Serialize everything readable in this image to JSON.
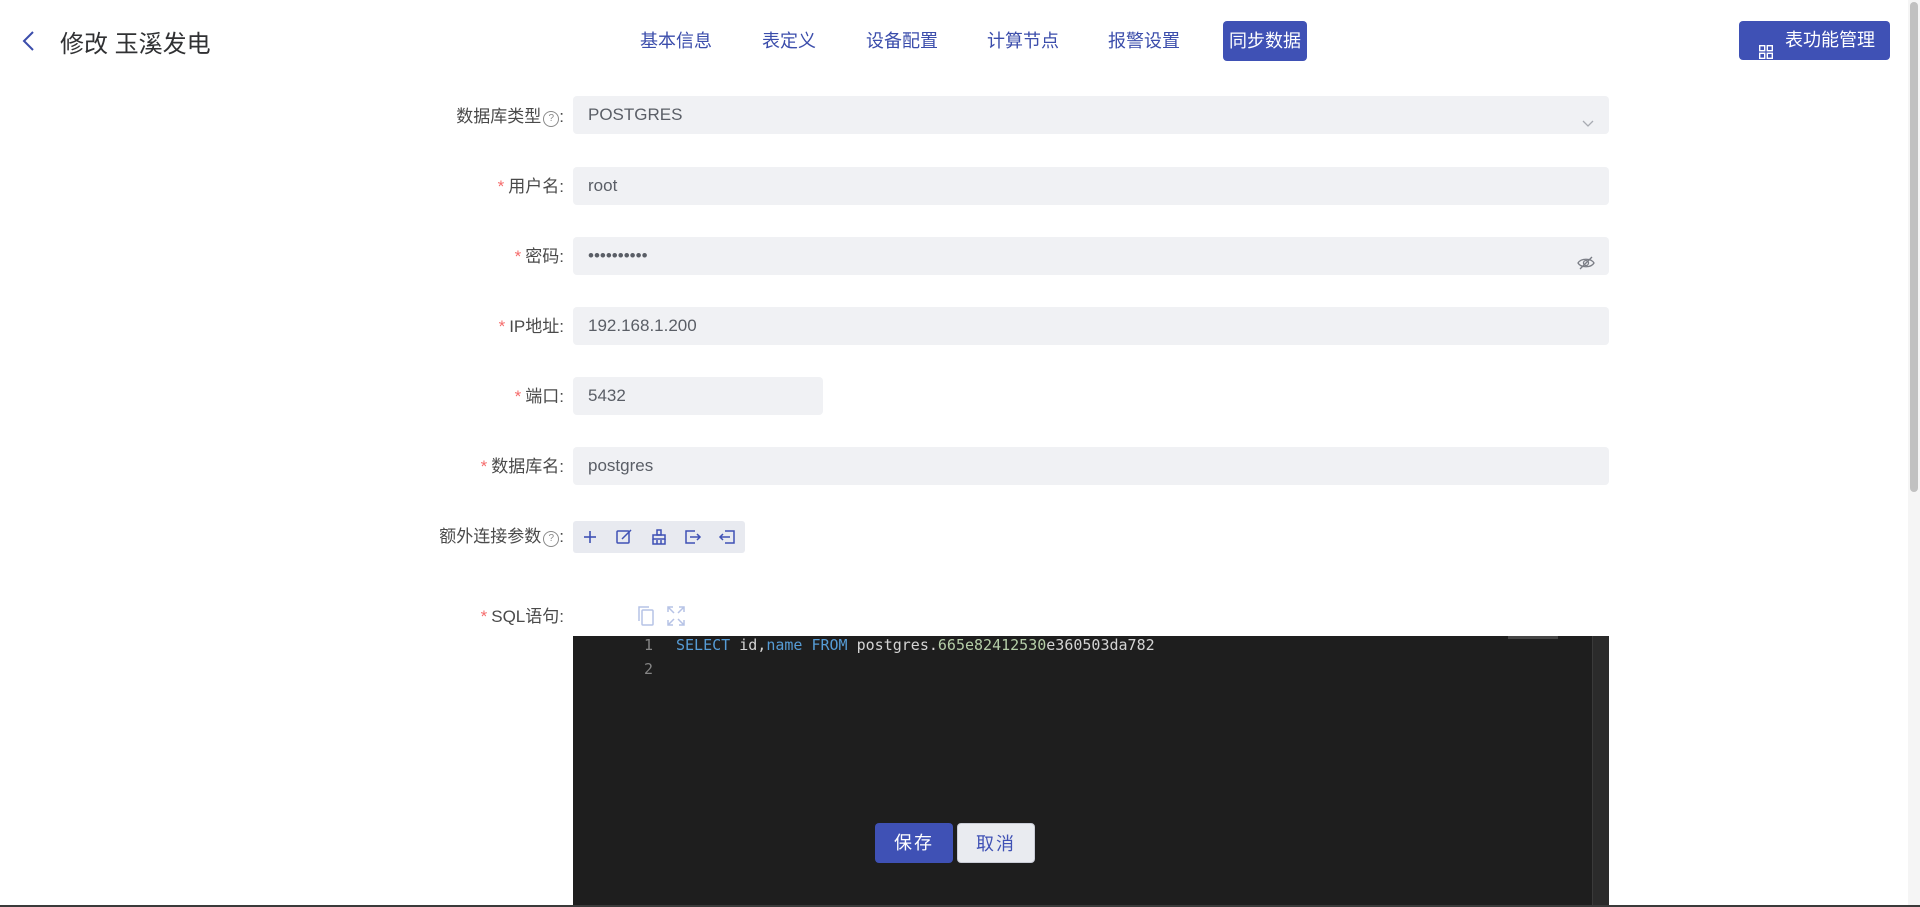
{
  "header": {
    "title": "修改 玉溪发电",
    "tabs": [
      {
        "label": "基本信息",
        "active": false
      },
      {
        "label": "表定义",
        "active": false
      },
      {
        "label": "设备配置",
        "active": false
      },
      {
        "label": "计算节点",
        "active": false
      },
      {
        "label": "报警设置",
        "active": false
      },
      {
        "label": "同步数据",
        "active": true
      }
    ],
    "function_button": "表功能管理"
  },
  "form": {
    "db_type": {
      "label": "数据库类型",
      "value": "POSTGRES"
    },
    "username": {
      "label": "用户名",
      "value": "root"
    },
    "password": {
      "label": "密码",
      "value": "••••••••••"
    },
    "ip": {
      "label": "IP地址",
      "value": "192.168.1.200"
    },
    "port": {
      "label": "端口",
      "value": "5432"
    },
    "db_name": {
      "label": "数据库名",
      "value": "postgres"
    },
    "extra_params": {
      "label": "额外连接参数"
    },
    "sql": {
      "label": "SQL语句",
      "lines": [
        {
          "number": "1",
          "keyword1": "SELECT",
          "text1": " id,",
          "keyword2": "name",
          "text2": " ",
          "keyword3": "FROM",
          "text3": " postgres.",
          "digits": "665e82412530",
          "text4": "e360503da782"
        },
        {
          "number": "2"
        }
      ]
    }
  },
  "required_mark": "*",
  "colon": ":",
  "help_mark": "?",
  "buttons": {
    "save": "保存",
    "cancel": "取消"
  },
  "colors": {
    "primary": "#3f51b5",
    "required": "#f56c6c",
    "editor_bg": "#1e1e1e"
  }
}
